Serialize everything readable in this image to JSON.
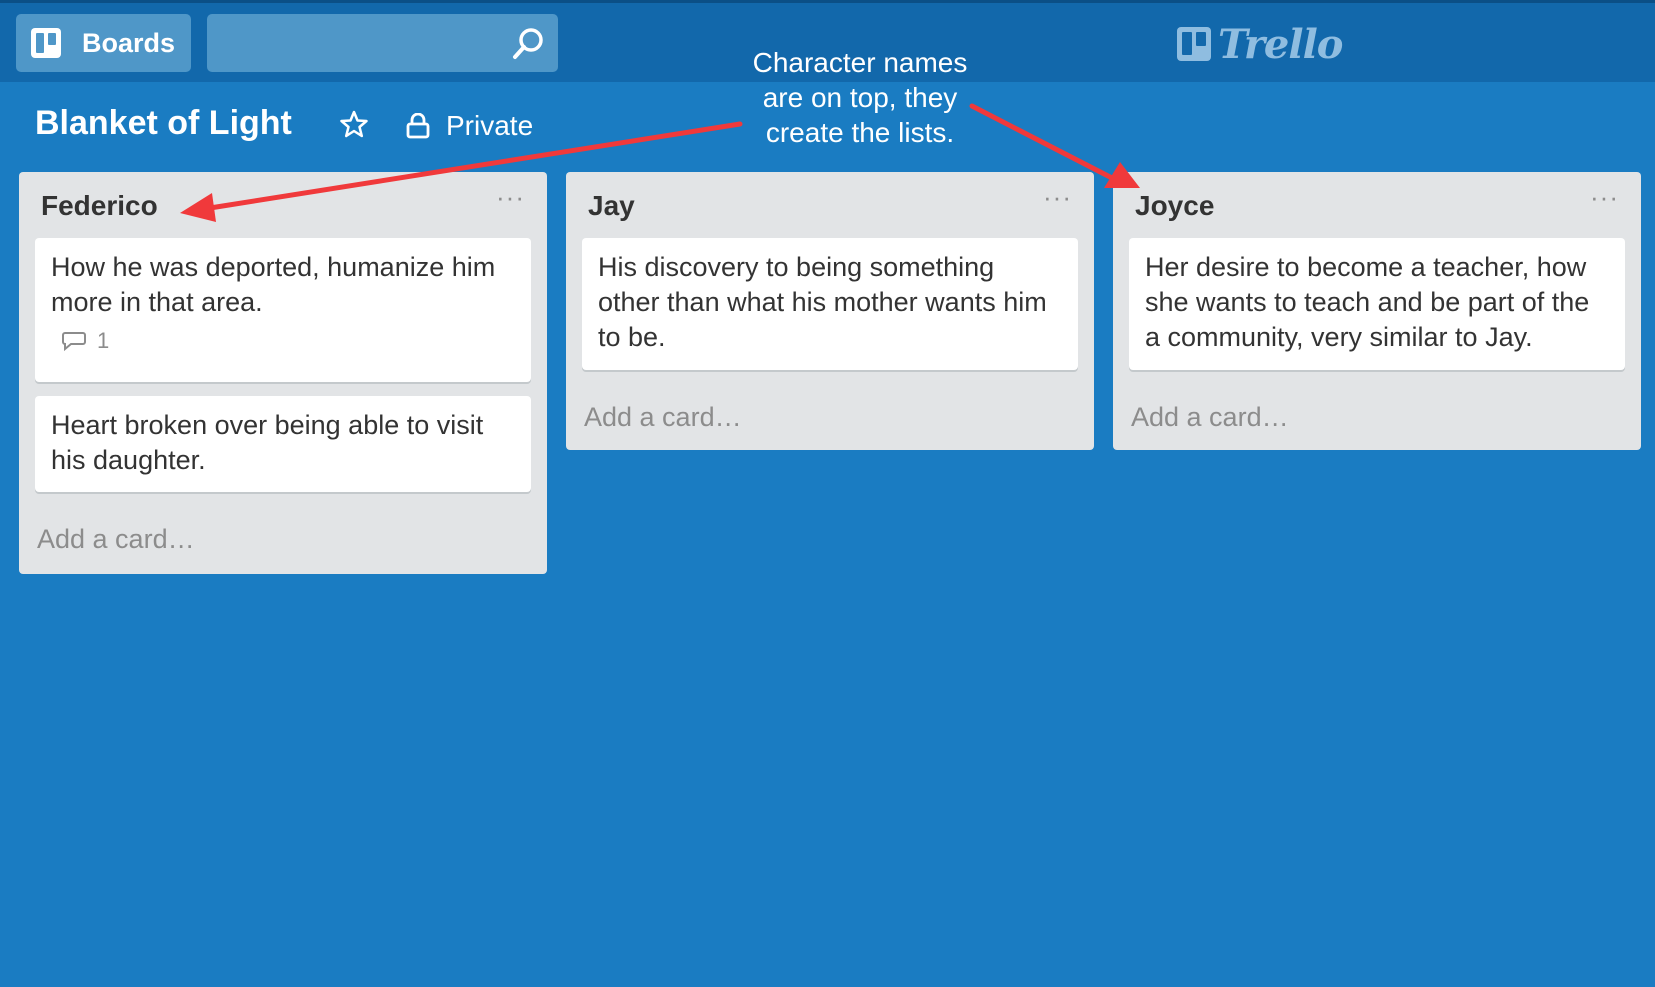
{
  "topbar": {
    "boards_label": "Boards",
    "search_value": "",
    "logo_text": "Trello"
  },
  "board": {
    "title": "Blanket of Light",
    "visibility": "Private"
  },
  "annotation": {
    "line1": "Character names",
    "line2": "are on top, they",
    "line3": "create the lists."
  },
  "lists": [
    {
      "title": "Federico",
      "menu": "···",
      "cards": [
        {
          "text": "How he was deported, humanize him more in that area.",
          "comments": "1"
        },
        {
          "text": "Heart broken over being able to visit his daughter."
        }
      ],
      "add_card": "Add a card…"
    },
    {
      "title": "Jay",
      "menu": "···",
      "cards": [
        {
          "text": "His discovery to being something other than what his mother wants him to be."
        }
      ],
      "add_card": "Add a card…"
    },
    {
      "title": "Joyce",
      "menu": "···",
      "cards": [
        {
          "text": "Her desire to become a teacher, how she wants to teach and be part of the a community, very similar to Jay."
        }
      ],
      "add_card": "Add a card…"
    }
  ],
  "colors": {
    "background": "#1a7cc2",
    "topbar": "#1268ab",
    "annotation_arrow": "#f0393b",
    "list_bg": "#e2e4e6"
  },
  "icons": [
    "boards-icon",
    "search-icon",
    "trello-logo-icon",
    "star-icon",
    "lock-icon",
    "comment-icon"
  ]
}
